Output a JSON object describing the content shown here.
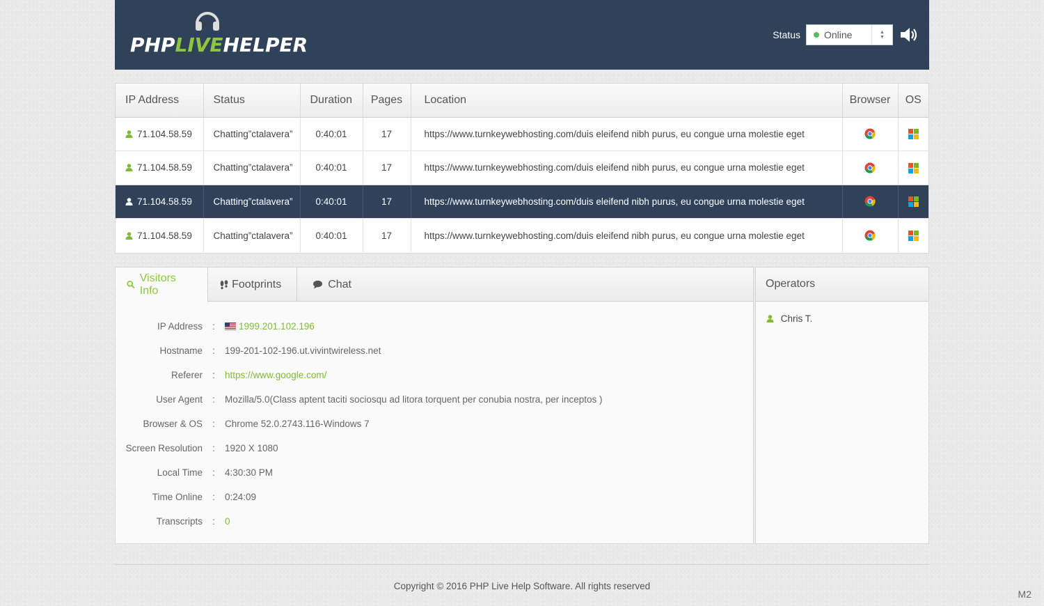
{
  "header": {
    "logo_php": "PHP",
    "logo_live": "LIVE",
    "logo_helper": "HELPER",
    "status_label": "Status",
    "status_value": "Online",
    "accent_color": "#8dc63f",
    "header_bg": "#2f4259"
  },
  "visitors_table": {
    "columns": [
      "IP Address",
      "Status",
      "Duration",
      "Pages",
      "Location",
      "Browser",
      "OS"
    ],
    "rows": [
      {
        "ip": "71.104.58.59",
        "status": "Chatting”ctalavera”",
        "duration": "0:40:01",
        "pages": "17",
        "location": "https://www.turnkeywebhosting.com/duis eleifend nibh purus, eu congue urna molestie eget",
        "browser_icon": "chrome-icon",
        "os_icon": "windows-icon"
      },
      {
        "ip": "71.104.58.59",
        "status": "Chatting”ctalavera”",
        "duration": "0:40:01",
        "pages": "17",
        "location": "https://www.turnkeywebhosting.com/duis eleifend nibh purus, eu congue urna molestie eget",
        "browser_icon": "chrome-icon",
        "os_icon": "windows-icon"
      },
      {
        "ip": "71.104.58.59",
        "status": "Chatting”ctalavera”",
        "duration": "0:40:01",
        "pages": "17",
        "location": "https://www.turnkeywebhosting.com/duis eleifend nibh purus, eu congue urna molestie eget",
        "browser_icon": "chrome-icon",
        "os_icon": "windows-icon",
        "selected": true
      },
      {
        "ip": "71.104.58.59",
        "status": "Chatting”ctalavera”",
        "duration": "0:40:01",
        "pages": "17",
        "location": "https://www.turnkeywebhosting.com/duis eleifend nibh purus, eu congue urna molestie eget",
        "browser_icon": "chrome-icon",
        "os_icon": "windows-icon"
      }
    ]
  },
  "tabs": [
    {
      "label": "Visitors Info",
      "icon": "search-icon",
      "active": true
    },
    {
      "label": "Footprints",
      "icon": "footprints-icon"
    },
    {
      "label": "Chat",
      "icon": "chat-bubble-icon"
    }
  ],
  "visitor_info": {
    "ip_label": "IP Address",
    "ip_value": "1999.201.102.196",
    "hostname_label": "Hostname",
    "hostname_value": "199-201-102-196.ut.vivintwireless.net",
    "referer_label": "Referer",
    "referer_value": "https://www.google.com/",
    "user_agent_label": "User Agent",
    "user_agent_value": "Mozilla/5.0(Class aptent taciti sociosqu ad litora torquent per conubia nostra, per inceptos )",
    "browser_os_label": "Browser & OS",
    "browser_os_value": "Chrome 52.0.2743.116-Windows 7",
    "resolution_label": "Screen Resolution",
    "resolution_value": "1920 X 1080",
    "local_time_label": "Local Time",
    "local_time_value": "4:30:30 PM",
    "time_online_label": "Time Online",
    "time_online_value": "0:24:09",
    "transcripts_label": "Transcripts",
    "transcripts_value": "0",
    "colon": ":"
  },
  "operators": {
    "title": "Operators",
    "items": [
      "Chris T."
    ]
  },
  "footer": {
    "copyright": "Copyright  ©  2016  PHP Live Help Software.  All rights reserved",
    "corner_label": "M2"
  }
}
